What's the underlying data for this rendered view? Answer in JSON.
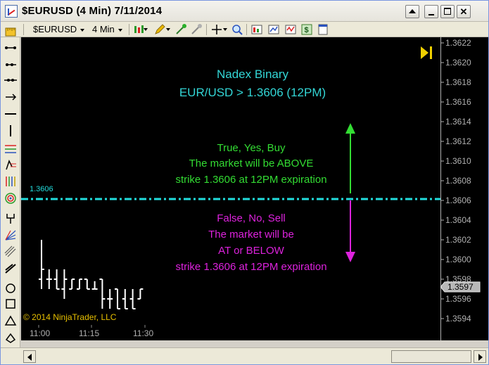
{
  "window": {
    "title": "$EURUSD (4 Min)  7/11/2014",
    "controls": [
      "up-arrow",
      "minimize",
      "maximize",
      "close"
    ]
  },
  "toolbar": {
    "instrument": "$EURUSD",
    "interval": "4 Min",
    "icons": [
      "bar-type-icon",
      "pencil-icon",
      "magnet-icon",
      "crosshair-icon",
      "zoom-icon",
      "properties-icon",
      "data-box-icon",
      "dollar-icon",
      "strategy-icon"
    ]
  },
  "left_tools": [
    "ruler-icon",
    "line-icon",
    "ray-icon",
    "extended-line-icon",
    "arrow-line-icon",
    "horizontal-line-icon",
    "vertical-line-icon",
    "fib-retracement-icon",
    "fib-extension-icon",
    "fib-time-icon",
    "fib-circle-icon",
    "andrews-pitchfork-icon",
    "gann-fan-icon",
    "regression-channel-icon",
    "trend-channel-icon",
    "ellipse-icon",
    "rectangle-icon",
    "triangle-icon",
    "polygon-icon"
  ],
  "chart": {
    "title_line1": "Nadex Binary",
    "title_line2": "EUR/USD > 1.3606 (12PM)",
    "above_lines": [
      "True, Yes, Buy",
      "The market will be ABOVE",
      "strike 1.3606 at 12PM expiration"
    ],
    "below_lines": [
      "False, No, Sell",
      "The market will be",
      "AT or BELOW",
      "strike 1.3606 at 12PM expiration"
    ],
    "strike_label": "1.3606",
    "copyright": "© 2014 NinjaTrader, LLC",
    "last_price": "1.3597",
    "colors": {
      "title": "#33d6d6",
      "above": "#33dd33",
      "below": "#dd22dd",
      "strike_line": "#22dddd",
      "go_to_end": "#f0d000"
    }
  },
  "chart_data": {
    "type": "ohlc",
    "y_ticks": [
      "1.3622",
      "1.3620",
      "1.3618",
      "1.3616",
      "1.3614",
      "1.3612",
      "1.3610",
      "1.3608",
      "1.3606",
      "1.3604",
      "1.3602",
      "1.3600",
      "1.3598",
      "1.3596",
      "1.3594"
    ],
    "x_ticks": [
      "11:00",
      "11:15",
      "11:30"
    ],
    "ylim": [
      1.3593,
      1.3623
    ],
    "bars": [
      {
        "o": 1.3598,
        "h": 1.3602,
        "l": 1.3597,
        "c": 1.3599
      },
      {
        "o": 1.3598,
        "h": 1.3599,
        "l": 1.3597,
        "c": 1.3598
      },
      {
        "o": 1.3598,
        "h": 1.3599,
        "l": 1.3597,
        "c": 1.3597
      },
      {
        "o": 1.3597,
        "h": 1.3599,
        "l": 1.3596,
        "c": 1.3598
      },
      {
        "o": 1.3597,
        "h": 1.3598,
        "l": 1.3597,
        "c": 1.3598
      },
      {
        "o": 1.3597,
        "h": 1.3598,
        "l": 1.3597,
        "c": 1.3598
      },
      {
        "o": 1.3598,
        "h": 1.3598,
        "l": 1.3597,
        "c": 1.3597
      },
      {
        "o": 1.3597,
        "h": 1.35978,
        "l": 1.3597,
        "c": 1.3597
      },
      {
        "o": 1.3598,
        "h": 1.3598,
        "l": 1.3595,
        "c": 1.3596
      },
      {
        "o": 1.3596,
        "h": 1.3597,
        "l": 1.3595,
        "c": 1.3596
      },
      {
        "o": 1.3597,
        "h": 1.3597,
        "l": 1.3595,
        "c": 1.3595
      },
      {
        "o": 1.3596,
        "h": 1.3597,
        "l": 1.3595,
        "c": 1.3595
      },
      {
        "o": 1.3596,
        "h": 1.3597,
        "l": 1.3595,
        "c": 1.3595
      },
      {
        "o": 1.3596,
        "h": 1.3597,
        "l": 1.3596,
        "c": 1.3597
      }
    ]
  }
}
